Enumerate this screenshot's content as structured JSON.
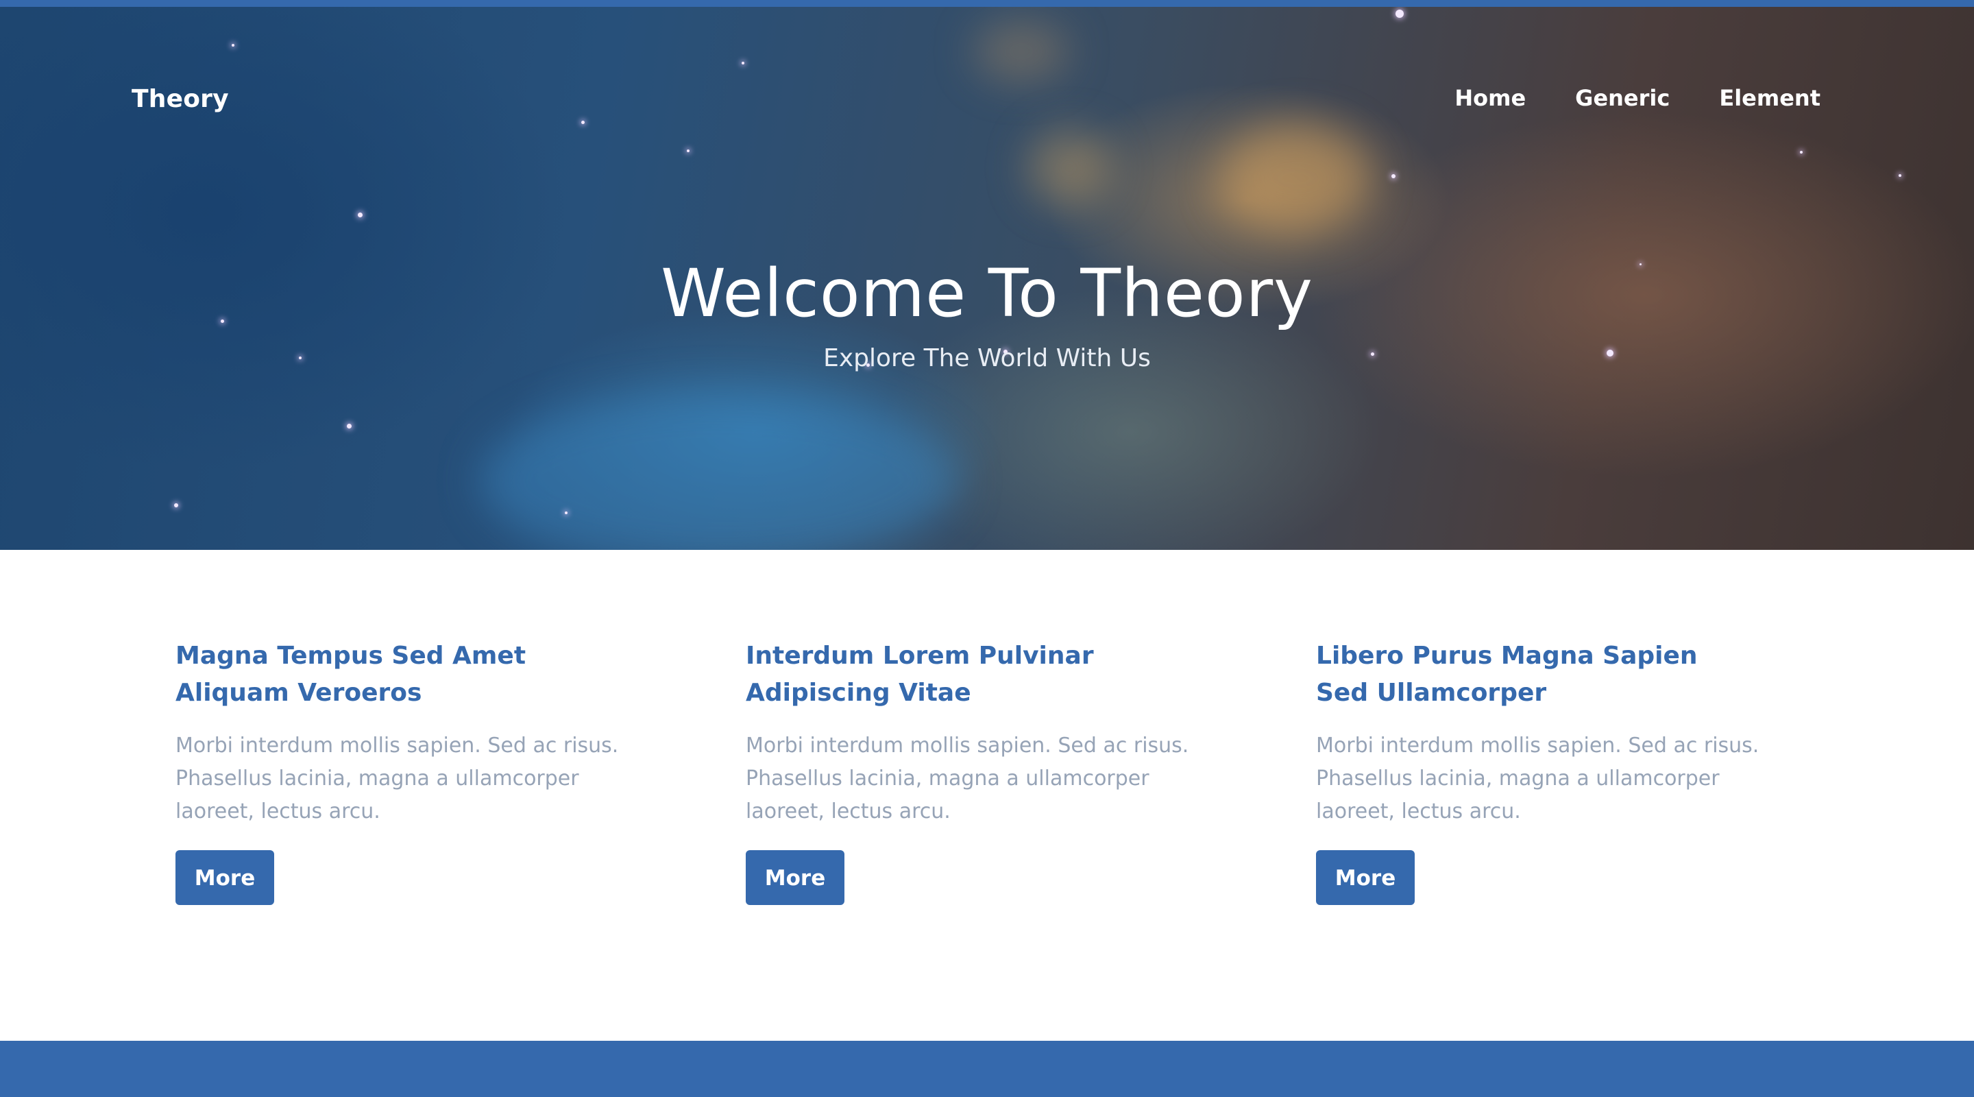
{
  "header": {
    "logo": "Theory",
    "nav": [
      {
        "label": "Home"
      },
      {
        "label": "Generic"
      },
      {
        "label": "Element"
      }
    ]
  },
  "hero": {
    "title": "Welcome To Theory",
    "subtitle": "Explore The World With Us"
  },
  "features": [
    {
      "title_line1": "Magna Tempus Sed Amet",
      "title_line2": "Aliquam Veroeros",
      "text": "Morbi interdum mollis sapien. Sed ac risus. Phasellus lacinia, magna a ullamcorper laoreet, lectus arcu.",
      "button": "More"
    },
    {
      "title_line1": "Interdum Lorem Pulvinar",
      "title_line2": "Adipiscing Vitae",
      "text": "Morbi interdum mollis sapien. Sed ac risus. Phasellus lacinia, magna a ullamcorper laoreet, lectus arcu.",
      "button": "More"
    },
    {
      "title_line1": "Libero Purus Magna Sapien",
      "title_line2": "Sed Ullamcorper",
      "text": "Morbi interdum mollis sapien. Sed ac risus. Phasellus lacinia, magna a ullamcorper laoreet, lectus arcu.",
      "button": "More"
    }
  ],
  "colors": {
    "accent": "#3569ad",
    "body_text": "#96a3b6"
  }
}
